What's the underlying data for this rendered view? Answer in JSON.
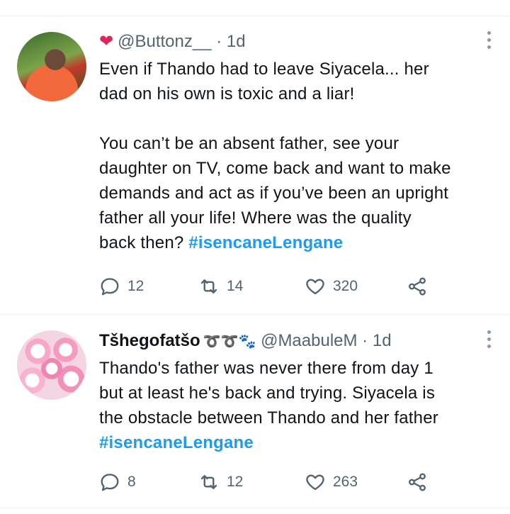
{
  "tweets": [
    {
      "display_name": "",
      "badge_icon": "red-heart-icon",
      "handle": "@Buttonz__",
      "separator": "·",
      "time": "1d",
      "text_main": "Even if Thando had to leave Siyacela... her\ndad on his own is toxic and a liar!\n\nYou can’t be an absent father, see your\ndaughter on TV, come back and want to make\ndemands and act as if you’ve been an upright\nfather all your life! Where was the quality\nback then? ",
      "hashtag": "#isencaneLengane",
      "replies": "12",
      "retweets": "14",
      "likes": "320"
    },
    {
      "display_name": "Tšhegofatšo",
      "badge_icon": "ribbon-paw-emoji-icons",
      "handle": "@MaabuleM",
      "separator": "·",
      "time": "1d",
      "text_main": "Thando's father was never there from day 1\nbut at least he's back and trying. Siyacela is\nthe obstacle between Thando and her father\n",
      "hashtag": "#isencaneLengane",
      "replies": "8",
      "retweets": "12",
      "likes": "263"
    }
  ],
  "colors": {
    "text": "#0f1419",
    "muted": "#536471",
    "hashtag": "#1d9bf0",
    "divider": "#eff3f4"
  }
}
